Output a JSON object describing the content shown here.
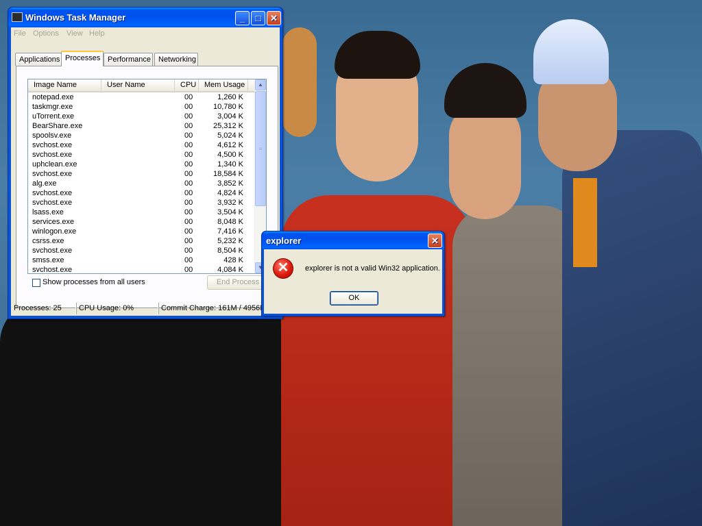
{
  "task_manager": {
    "title": "Windows Task Manager",
    "menu": [
      "File",
      "Options",
      "View",
      "Help"
    ],
    "tabs": [
      "Applications",
      "Processes",
      "Performance",
      "Networking"
    ],
    "active_tab": "Processes",
    "columns": [
      "Image Name",
      "User Name",
      "CPU",
      "Mem Usage"
    ],
    "processes": [
      {
        "name": "notepad.exe",
        "user": "",
        "cpu": "00",
        "mem": "1,260 K"
      },
      {
        "name": "taskmgr.exe",
        "user": "",
        "cpu": "00",
        "mem": "10,780 K"
      },
      {
        "name": "uTorrent.exe",
        "user": "",
        "cpu": "00",
        "mem": "3,004 K"
      },
      {
        "name": "BearShare.exe",
        "user": "",
        "cpu": "00",
        "mem": "25,312 K"
      },
      {
        "name": "spoolsv.exe",
        "user": "",
        "cpu": "00",
        "mem": "5,024 K"
      },
      {
        "name": "svchost.exe",
        "user": "",
        "cpu": "00",
        "mem": "4,612 K"
      },
      {
        "name": "svchost.exe",
        "user": "",
        "cpu": "00",
        "mem": "4,500 K"
      },
      {
        "name": "uphclean.exe",
        "user": "",
        "cpu": "00",
        "mem": "1,340 K"
      },
      {
        "name": "svchost.exe",
        "user": "",
        "cpu": "00",
        "mem": "18,584 K"
      },
      {
        "name": "alg.exe",
        "user": "",
        "cpu": "00",
        "mem": "3,852 K"
      },
      {
        "name": "svchost.exe",
        "user": "",
        "cpu": "00",
        "mem": "4,824 K"
      },
      {
        "name": "svchost.exe",
        "user": "",
        "cpu": "00",
        "mem": "3,932 K"
      },
      {
        "name": "lsass.exe",
        "user": "",
        "cpu": "00",
        "mem": "3,504 K"
      },
      {
        "name": "services.exe",
        "user": "",
        "cpu": "00",
        "mem": "8,048 K"
      },
      {
        "name": "winlogon.exe",
        "user": "",
        "cpu": "00",
        "mem": "7,416 K"
      },
      {
        "name": "csrss.exe",
        "user": "",
        "cpu": "00",
        "mem": "5,232 K"
      },
      {
        "name": "svchost.exe",
        "user": "",
        "cpu": "00",
        "mem": "8,504 K"
      },
      {
        "name": "smss.exe",
        "user": "",
        "cpu": "00",
        "mem": "428 K"
      },
      {
        "name": "svchost.exe",
        "user": "",
        "cpu": "00",
        "mem": "4,084 K"
      }
    ],
    "show_all_label": "Show processes from all users",
    "end_process_label": "End Process",
    "status": {
      "processes": "Processes: 25",
      "cpu": "CPU Usage: 0%",
      "commit": "Commit Charge: 161M / 4956M"
    }
  },
  "dialog": {
    "title": "explorer",
    "message": "explorer is not a valid Win32 application.",
    "ok_label": "OK",
    "icon": "error-icon"
  },
  "colors": {
    "titlebar": "#0053ee",
    "window_face": "#ece9d8",
    "close_button": "#c5401c",
    "active_tab_accent": "#ffc83c"
  }
}
